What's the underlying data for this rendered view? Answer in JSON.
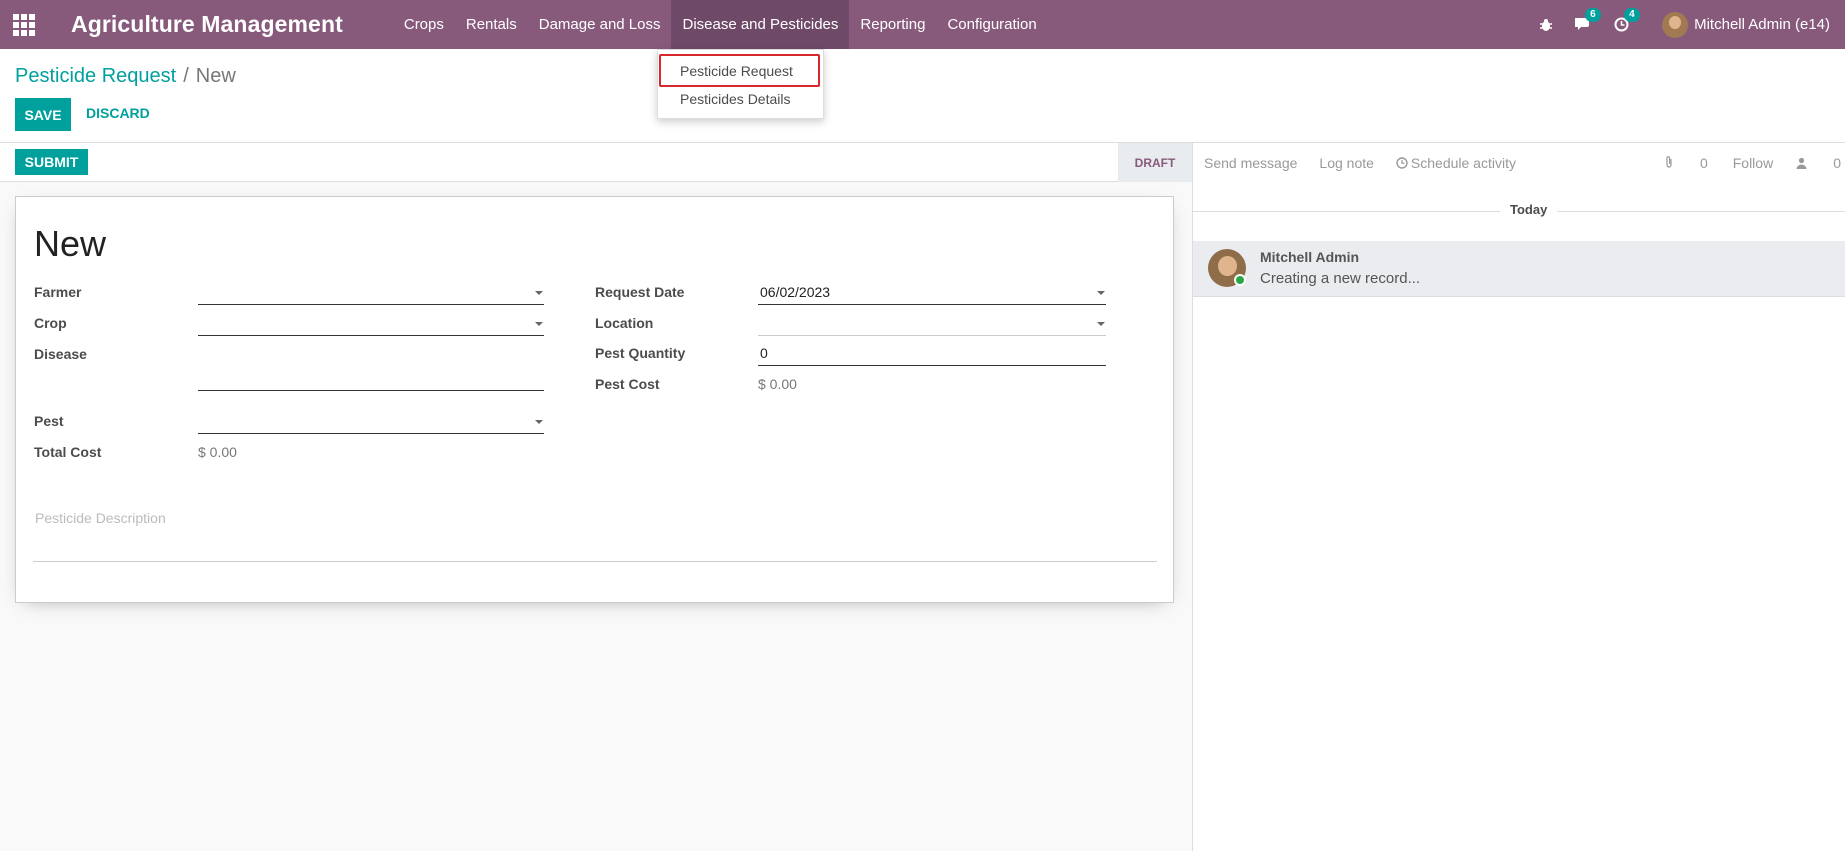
{
  "navbar": {
    "brand": "Agriculture Management",
    "menu": [
      {
        "label": "Crops"
      },
      {
        "label": "Rentals"
      },
      {
        "label": "Damage and Loss"
      },
      {
        "label": "Disease and Pesticides"
      },
      {
        "label": "Reporting"
      },
      {
        "label": "Configuration"
      }
    ],
    "messages_count": "6",
    "activities_count": "4",
    "user_name": "Mitchell Admin (e14)"
  },
  "dropdown": {
    "items": [
      {
        "label": "Pesticide Request"
      },
      {
        "label": "Pesticides Details"
      }
    ]
  },
  "breadcrumb": {
    "parent": "Pesticide Request",
    "separator": "/",
    "current": "New"
  },
  "buttons": {
    "save": "SAVE",
    "discard": "DISCARD",
    "submit": "SUBMIT"
  },
  "status": {
    "current": "DRAFT"
  },
  "form": {
    "title": "New",
    "left": {
      "farmer_label": "Farmer",
      "farmer_value": "",
      "crop_label": "Crop",
      "crop_value": "",
      "disease_label": "Disease",
      "disease_value": "",
      "pest_label": "Pest",
      "pest_value": "",
      "total_cost_label": "Total Cost",
      "total_cost_value": "$ 0.00"
    },
    "right": {
      "request_date_label": "Request Date",
      "request_date_value": "06/02/2023",
      "location_label": "Location",
      "location_value": "",
      "pest_quantity_label": "Pest Quantity",
      "pest_quantity_value": "0",
      "pest_cost_label": "Pest Cost",
      "pest_cost_value": "$ 0.00"
    },
    "description_placeholder": "Pesticide Description"
  },
  "chatter": {
    "send_message": "Send message",
    "log_note": "Log note",
    "schedule_activity": "Schedule activity",
    "attachments_count": "0",
    "follow": "Follow",
    "followers_count": "0",
    "date_separator": "Today",
    "message_author": "Mitchell Admin",
    "message_body": "Creating a new record..."
  },
  "colors": {
    "navbar": "#875a7b",
    "primary": "#00a09d",
    "highlight": "#d9272e"
  }
}
